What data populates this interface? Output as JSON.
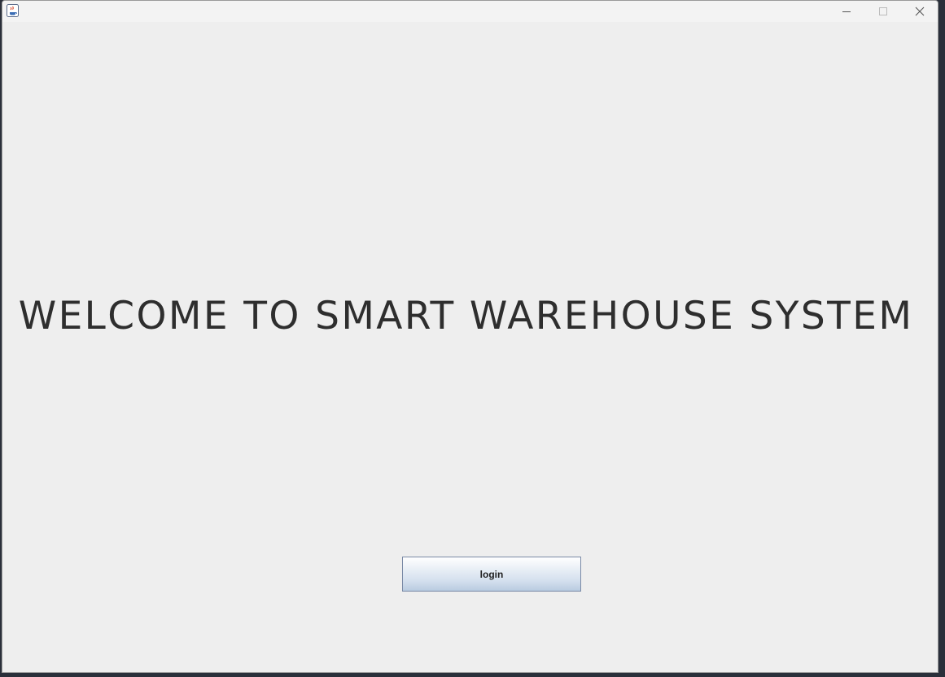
{
  "window": {
    "title": "",
    "icon": "java-cup-icon",
    "controls": {
      "minimize": "minimize-icon",
      "maximize": "maximize-icon",
      "close": "close-icon"
    }
  },
  "main": {
    "welcome_text": "WELCOME TO SMART WAREHOUSE SYSTEM",
    "login_label": "login"
  },
  "colors": {
    "background": "#eeeeee",
    "text": "#2e2e2e",
    "button_border": "#7a8aa6"
  }
}
